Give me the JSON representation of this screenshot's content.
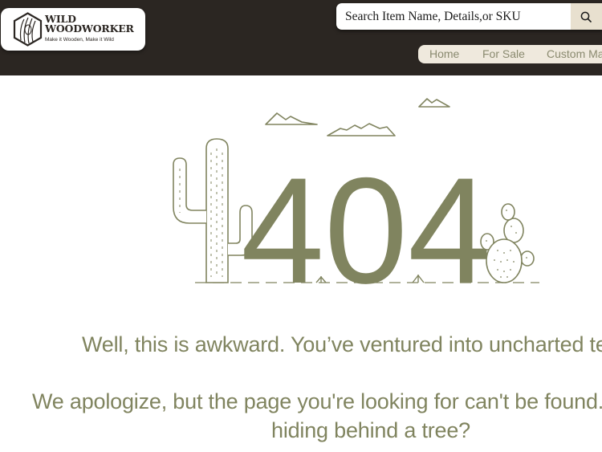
{
  "brand": {
    "name_line1": "WILD",
    "name_line2": "WOODWORKER",
    "tagline": "Make it Wooden,  Make it Wild"
  },
  "search": {
    "placeholder": "Search Item Name, Details,or SKU",
    "icon": "search-icon"
  },
  "nav": {
    "items": [
      "Home",
      "For Sale",
      "Custom Ma"
    ]
  },
  "error": {
    "code": "404",
    "headline": "Well, this is awkward. You’ve ventured into uncharted ter",
    "body_line1": "We apologize, but the page you're looking for can't be found.",
    "body_line2": "hiding behind a tree?"
  },
  "colors": {
    "header_bg": "#2b2622",
    "accent_olive": "#80845f",
    "nav_bg": "#efe9dd",
    "search_btn_bg": "#e8e0cf"
  }
}
